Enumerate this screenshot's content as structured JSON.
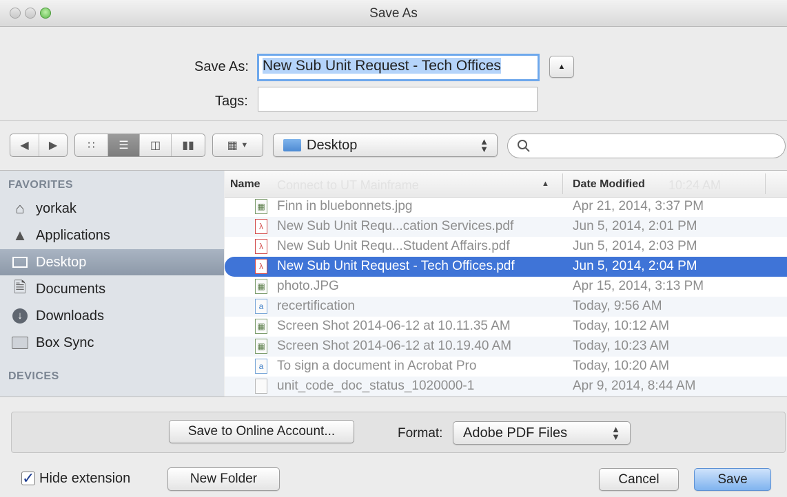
{
  "window": {
    "title": "Save As"
  },
  "form": {
    "save_as_label": "Save As:",
    "save_as_value": "New Sub Unit Request - Tech Offices",
    "tags_label": "Tags:",
    "tags_value": ""
  },
  "toolbar": {
    "location": "Desktop",
    "search_placeholder": "",
    "view_active": "list"
  },
  "sidebar": {
    "favorites_header": "FAVORITES",
    "items": [
      {
        "label": "yorkak",
        "icon": "home-icon"
      },
      {
        "label": "Applications",
        "icon": "applications-icon"
      },
      {
        "label": "Desktop",
        "icon": "desktop-icon",
        "active": true
      },
      {
        "label": "Documents",
        "icon": "documents-icon"
      },
      {
        "label": "Downloads",
        "icon": "downloads-icon"
      },
      {
        "label": "Box Sync",
        "icon": "folder-icon"
      }
    ],
    "devices_header": "DEVICES"
  },
  "file_list": {
    "columns": {
      "name": "Name",
      "date": "Date Modified"
    },
    "ghost_name": "Connect to UT Mainframe",
    "ghost_date": "10:24 AM",
    "files": [
      {
        "name": "Finn in bluebonnets.jpg",
        "date": "Apr 21, 2014, 3:37 PM",
        "kind": "img"
      },
      {
        "name": "New Sub Unit Requ...cation Services.pdf",
        "date": "Jun 5, 2014, 2:01 PM",
        "kind": "pdf"
      },
      {
        "name": "New Sub Unit Requ...Student Affairs.pdf",
        "date": "Jun 5, 2014, 2:03 PM",
        "kind": "pdf"
      },
      {
        "name": "New Sub Unit Request - Tech Offices.pdf",
        "date": "Jun 5, 2014, 2:04 PM",
        "kind": "pdf",
        "selected": true
      },
      {
        "name": "photo.JPG",
        "date": "Apr 15, 2014, 3:13 PM",
        "kind": "img"
      },
      {
        "name": "recertification",
        "date": "Today, 9:56 AM",
        "kind": "doc"
      },
      {
        "name": "Screen Shot 2014-06-12 at 10.11.35 AM",
        "date": "Today, 10:12 AM",
        "kind": "img"
      },
      {
        "name": "Screen Shot 2014-06-12 at 10.19.40 AM",
        "date": "Today, 10:23 AM",
        "kind": "img"
      },
      {
        "name": "To sign a document in Acrobat Pro",
        "date": "Today, 10:20 AM",
        "kind": "doc"
      },
      {
        "name": "unit_code_doc_status_1020000-1",
        "date": "Apr 9, 2014, 8:44 AM",
        "kind": "file"
      }
    ]
  },
  "accessory": {
    "online_button": "Save to Online Account...",
    "format_label": "Format:",
    "format_value": "Adobe PDF Files"
  },
  "footer": {
    "hide_extension_label": "Hide extension",
    "hide_extension_checked": true,
    "new_folder_button": "New Folder",
    "cancel_button": "Cancel",
    "save_button": "Save"
  }
}
